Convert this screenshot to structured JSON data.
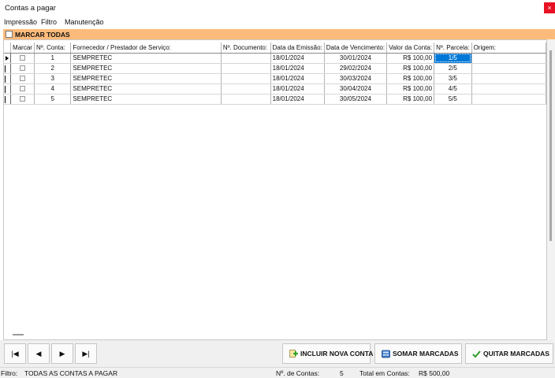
{
  "window": {
    "title": "Contas a pagar",
    "close_glyph": "×"
  },
  "menu": {
    "items": [
      "Impressão",
      "Filtro",
      "Manutenção"
    ]
  },
  "select_all": {
    "label": "MARCAR TODAS",
    "checked": false
  },
  "grid": {
    "columns": [
      "Marcar",
      "Nº. Conta:",
      "Fornecedor / Prestador de Serviço:",
      "Nº. Documento:",
      "Data da Emissão:",
      "Data de Vencimento:",
      "Valor da Conta:",
      "Nº. Parcela:",
      "Origem:"
    ],
    "rows": [
      {
        "conta": "1",
        "fornecedor": "SEMPRETEC",
        "documento": "",
        "emissao": "18/01/2024",
        "vencimento": "30/01/2024",
        "valor": "R$ 100,00",
        "parcela": "1/5",
        "origem": ""
      },
      {
        "conta": "2",
        "fornecedor": "SEMPRETEC",
        "documento": "",
        "emissao": "18/01/2024",
        "vencimento": "29/02/2024",
        "valor": "R$ 100,00",
        "parcela": "2/5",
        "origem": ""
      },
      {
        "conta": "3",
        "fornecedor": "SEMPRETEC",
        "documento": "",
        "emissao": "18/01/2024",
        "vencimento": "30/03/2024",
        "valor": "R$ 100,00",
        "parcela": "3/5",
        "origem": ""
      },
      {
        "conta": "4",
        "fornecedor": "SEMPRETEC",
        "documento": "",
        "emissao": "18/01/2024",
        "vencimento": "30/04/2024",
        "valor": "R$ 100,00",
        "parcela": "4/5",
        "origem": ""
      },
      {
        "conta": "5",
        "fornecedor": "SEMPRETEC",
        "documento": "",
        "emissao": "18/01/2024",
        "vencimento": "30/05/2024",
        "valor": "R$ 100,00",
        "parcela": "5/5",
        "origem": ""
      }
    ]
  },
  "nav": {
    "first": "|◀",
    "prev": "◀",
    "next": "▶",
    "last": "▶|"
  },
  "buttons": {
    "incluir": "INCLUIR NOVA CONTA",
    "somar": "SOMAR MARCADAS",
    "quitar": "QUITAR MARCADAS"
  },
  "status": {
    "filtro_label": "Filtro:",
    "filtro_value": "TODAS AS CONTAS A PAGAR",
    "contas_label": "Nº. de Contas:",
    "contas_value": "5",
    "total_label": "Total em Contas:",
    "total_value": "R$ 500,00"
  },
  "colors": {
    "accent_orange": "#fdbb7b",
    "selection_blue": "#0078d7",
    "close_red": "#e81123"
  }
}
